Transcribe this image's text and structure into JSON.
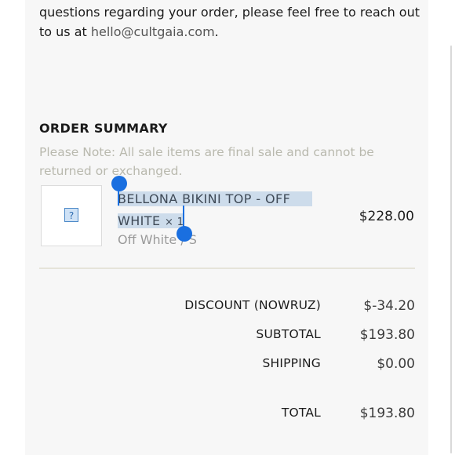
{
  "intro": {
    "line1": "questions regarding your order, please feel free to reach out",
    "line2_prefix": "to us at ",
    "email": "hello@cultgaia.com",
    "line2_suffix": "."
  },
  "order_summary": {
    "title": "ORDER SUMMARY",
    "note": "Please Note: All sale items are final sale and cannot be returned or exchanged.",
    "item": {
      "image_icon": "broken-image-icon",
      "name_line1": "BELLONA BIKINI TOP - OFF",
      "name_line2": "WHITE",
      "quantity_text": "× 1",
      "variant": "Off White / S",
      "price": "$228.00"
    },
    "rows": [
      {
        "label": "DISCOUNT (NOWRUZ)",
        "value": "$-34.20"
      },
      {
        "label": "SUBTOTAL",
        "value": "$193.80"
      },
      {
        "label": "SHIPPING",
        "value": "$0.00"
      }
    ],
    "total": {
      "label": "TOTAL",
      "value": "$193.80"
    }
  },
  "colors": {
    "selection": "#cddceb",
    "handle": "#1a6fe0",
    "note_text": "#b9b9ae"
  }
}
